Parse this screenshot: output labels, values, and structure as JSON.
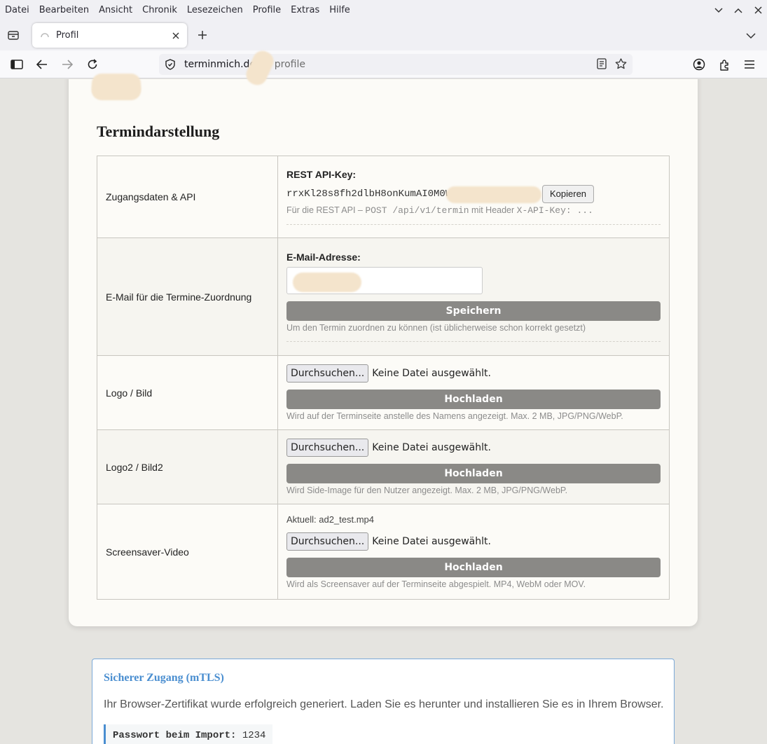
{
  "menubar": {
    "items": [
      "Datei",
      "Bearbeiten",
      "Ansicht",
      "Chronik",
      "Lesezeichen",
      "Profile",
      "Extras",
      "Hilfe"
    ]
  },
  "tab": {
    "title": "Profil"
  },
  "urlbar": {
    "host": "terminmich.de/",
    "path": "profile"
  },
  "section": {
    "title": "Termindarstellung"
  },
  "rows": {
    "api": {
      "label": "Zugangsdaten & API",
      "field_label": "REST API-Key:",
      "key": "rrxKl28s8fh2dlbH8onKumAI0M0W",
      "copy_label": "Kopieren",
      "hint_prefix": "Für die REST API – ",
      "hint_code1": "POST /api/v1/termin",
      "hint_mid": " mit Header ",
      "hint_code2": "X-API-Key: ..."
    },
    "email": {
      "label": "E-Mail für die Termine-Zuordnung",
      "field_label": "E-Mail-Adresse:",
      "button": "Speichern",
      "hint": "Um den Termin zuordnen zu können (ist üblicherweise schon korrekt gesetzt)"
    },
    "logo": {
      "label": "Logo / Bild",
      "browse": "Durchsuchen...",
      "no_file": "Keine Datei ausgewählt.",
      "button": "Hochladen",
      "hint": "Wird auf der Terminseite anstelle des Namens angezeigt. Max. 2 MB, JPG/PNG/WebP."
    },
    "logo2": {
      "label": "Logo2 / Bild2",
      "browse": "Durchsuchen...",
      "no_file": "Keine Datei ausgewählt.",
      "button": "Hochladen",
      "hint": "Wird Side-Image für den Nutzer angezeigt. Max. 2 MB, JPG/PNG/WebP."
    },
    "video": {
      "label": "Screensaver-Video",
      "current": "Aktuell: ad2_test.mp4",
      "browse": "Durchsuchen...",
      "no_file": "Keine Datei ausgewählt.",
      "button": "Hochladen",
      "hint": "Wird als Screensaver auf der Terminseite abgespielt. MP4, WebM oder MOV."
    }
  },
  "mtls": {
    "title": "Sicherer Zugang (mTLS)",
    "text": "Ihr Browser-Zertifikat wurde erfolgreich generiert. Laden Sie es herunter und installieren Sie es in Ihrem Browser.",
    "pw_label": "Passwort beim Import:",
    "pw_value": "1234"
  },
  "icons": {
    "tab-list": "tab-list-icon",
    "close": "close-icon",
    "plus": "plus-icon",
    "chevron": "chevron-down-icon",
    "sidebar": "sidebar-icon",
    "back": "back-arrow-icon",
    "forward": "forward-arrow-icon",
    "reload": "reload-icon",
    "shield": "shield-icon",
    "reader": "reader-view-icon",
    "star": "bookmark-star-icon",
    "account": "account-icon",
    "extensions": "extensions-icon",
    "menu": "hamburger-menu-icon"
  },
  "colors": {
    "accent_blue": "#4a8ed0",
    "button_gray": "#8a8986",
    "page_bg": "#e5e4e0",
    "card_bg": "#fcfbf7"
  }
}
